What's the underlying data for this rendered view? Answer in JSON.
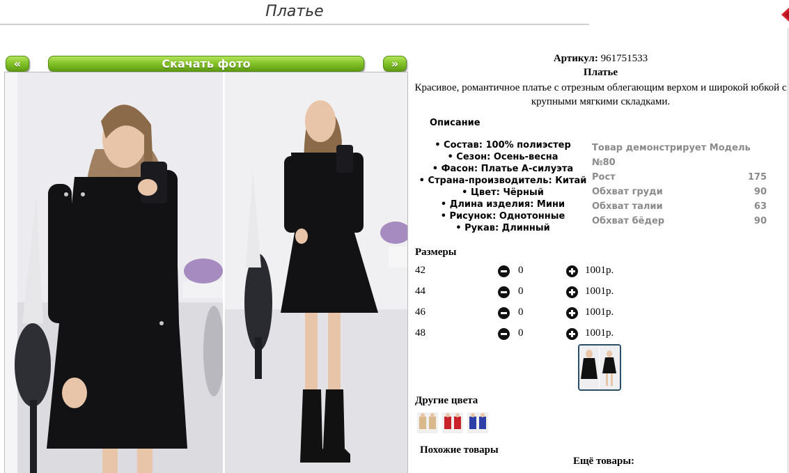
{
  "page": {
    "title": "Платье"
  },
  "gallery": {
    "prev_label": "«",
    "download_label": "Скачать фото",
    "next_label": "»"
  },
  "product": {
    "article_label": "Артикул:",
    "article_value": "961751533",
    "name": "Платье",
    "description": "Красивое, романтичное платье с отрезным облегающим верхом и широкой юбкой с крупными мягкими складками."
  },
  "details": {
    "heading": "Описание",
    "properties": [
      "• Состав: 100% полиэстер",
      "• Сезон: Осень-весна",
      "• Фасон: Платье А-силуэта",
      "• Страна-производитель: Китай",
      "• Цвет: Чёрный",
      "• Длина изделия: Мини",
      "• Рисунок: Однотонные",
      "• Рукав: Длинный"
    ],
    "model": {
      "title": "Товар демонстрирует Модель №80",
      "rows": [
        {
          "label": "Рост",
          "value": "175"
        },
        {
          "label": "Обхват груди",
          "value": "90"
        },
        {
          "label": "Обхват талии",
          "value": "63"
        },
        {
          "label": "Обхват бёдер",
          "value": "90"
        }
      ]
    }
  },
  "sizes": {
    "heading": "Размеры",
    "rows": [
      {
        "size": "42",
        "qty": "0",
        "price": "1001р."
      },
      {
        "size": "44",
        "qty": "0",
        "price": "1001р."
      },
      {
        "size": "46",
        "qty": "0",
        "price": "1001р."
      },
      {
        "size": "48",
        "qty": "0",
        "price": "1001р."
      }
    ]
  },
  "colors": {
    "heading": "Другие цвета",
    "swatches": [
      "#d8b98c",
      "#c8232b",
      "#2f3fa8"
    ]
  },
  "similar": {
    "heading": "Похожие товары"
  },
  "more": {
    "heading": "Ещё товары:"
  },
  "theme": {
    "button_green": "#86c52a",
    "link_green": "#1a7a1a",
    "muted_gray": "#8a8a8a"
  }
}
